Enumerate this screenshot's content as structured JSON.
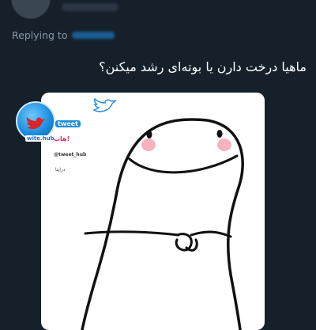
{
  "reply_context": {
    "label": "Replying to"
  },
  "tweet": {
    "text": "ماهیا درخت دارن یا بوته‌ای رشد میکنن؟"
  },
  "watermark": {
    "top_text": "هاب!",
    "tweet_label": "tweet",
    "handle": "@tweet_hub",
    "join_text": "درایتا",
    "site": "wite.hub"
  },
  "colors": {
    "background": "#15202b",
    "secondary_text": "#8899a6",
    "blush": "#f4a6b4"
  }
}
